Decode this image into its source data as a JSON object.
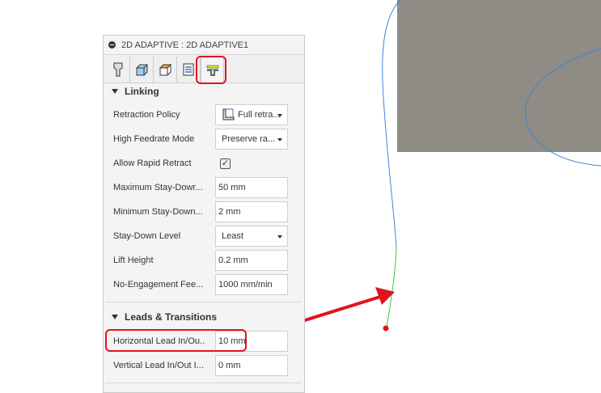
{
  "panel": {
    "title": "2D ADAPTIVE : 2D ADAPTIVE1",
    "tabs": [
      "tool",
      "geometry",
      "heights",
      "passes",
      "linking"
    ],
    "active_tab": "linking",
    "sections": [
      {
        "title": "Linking",
        "rows": [
          {
            "label": "Retraction Policy",
            "type": "select",
            "value": "Full retra..."
          },
          {
            "label": "High Feedrate Mode",
            "type": "select",
            "value": "Preserve ra..."
          },
          {
            "label": "Allow Rapid Retract",
            "type": "checkbox",
            "checked": true,
            "mark": "✓"
          },
          {
            "label": "Maximum Stay-Dowr...",
            "type": "input",
            "value": "50 mm"
          },
          {
            "label": "Minimum Stay-Down...",
            "type": "input",
            "value": "2 mm"
          },
          {
            "label": "Stay-Down Level",
            "type": "select",
            "value": "Least"
          },
          {
            "label": "Lift Height",
            "type": "input",
            "value": "0.2 mm"
          },
          {
            "label": "No-Engagement Fee...",
            "type": "input",
            "value": "1000 mm/min"
          }
        ]
      },
      {
        "title": "Leads & Transitions",
        "rows": [
          {
            "label": "Horizontal Lead In/Ou...",
            "type": "input",
            "value": "10 mm"
          },
          {
            "label": "Vertical Lead In/Out I...",
            "type": "input",
            "value": "0 mm"
          }
        ]
      }
    ]
  },
  "colors": {
    "highlight": "#e0141e",
    "toolpath": "#3a86d8",
    "lead": "#3cc83c",
    "stock": "#8e8c85"
  }
}
